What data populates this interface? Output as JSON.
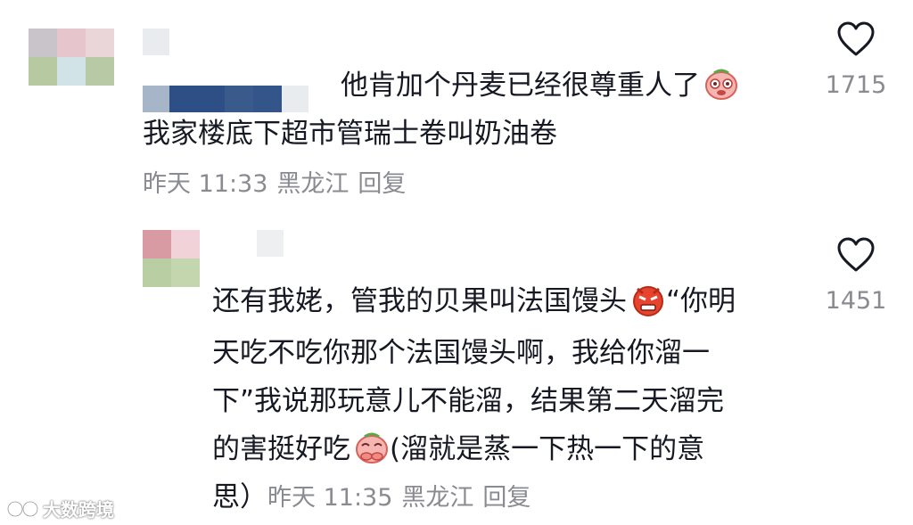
{
  "comment1": {
    "avatar_colors": [
      "#c9c4c9",
      "#e6c6cc",
      "#ead6d8",
      "#b6c9a0",
      "#d2e3e8",
      "#b8c9a6"
    ],
    "username_colors": [
      "#a7b5c9",
      "#2e4f85",
      "#3a5a8c",
      "#33558a",
      "#e8ecef"
    ],
    "body_line1": "他肯加个丹麦已经很尊重人了",
    "body_line2": "我家楼底下超市管瑞士卷叫奶油卷",
    "time": "昨天 11:33",
    "location": "黑龙江",
    "reply_label": "回复",
    "like_count": "1715",
    "emoji": "crying-face-emoji"
  },
  "comment2": {
    "avatar_colors": [
      "#d89aa3",
      "#f0d2d8",
      "#b9cfa3",
      "#c3d6ae"
    ],
    "body_lines": [
      "还有我姥，管我的贝果叫法国馒头",
      "天吃不吃你那个法国馒头啊，我给你溜一",
      "下”我说那玩意儿不能溜，结果第二天溜完",
      "的害挺好吃",
      "思）"
    ],
    "line1_tail": "“你明",
    "line4_tail": "(溜就是蒸一下热一下的意",
    "time": "昨天 11:35",
    "location": "黑龙江",
    "reply_label": "回复",
    "like_count": "1451",
    "emoji1": "angry-face-emoji",
    "emoji2": "covering-mouth-emoji"
  },
  "watermark": {
    "text": "大数跨境"
  },
  "icons": {
    "like": "heart-outline-icon"
  },
  "colors": {
    "text": "#161823",
    "meta": "#8a8b91",
    "emoji_face": "#f6b5b0",
    "emoji_angry": "#e8432e"
  }
}
